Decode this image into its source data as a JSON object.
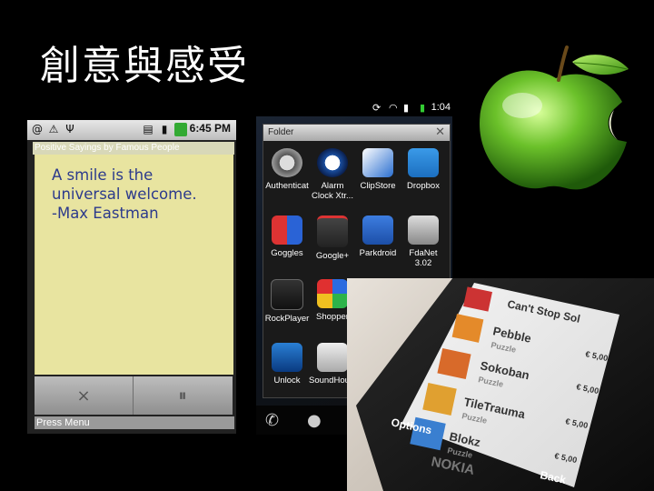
{
  "slide": {
    "title": "創意與感受"
  },
  "phone1": {
    "status_time": "6:45 PM",
    "app_title": "Positive Sayings by Famous People",
    "quote_lines": [
      "A smile is the",
      "universal welcome.",
      "-Max Eastman"
    ],
    "close_symbol": "×",
    "pause_symbol": "⏸",
    "menu_hint": "Press Menu"
  },
  "phone2": {
    "status_time": "1:04",
    "folder_title": "Folder",
    "apps": [
      {
        "label": "Authenticat",
        "icon": "authenticator-icon"
      },
      {
        "label": "Alarm\nClock Xtr...",
        "icon": "alarm-clock-icon"
      },
      {
        "label": "ClipStore",
        "icon": "clipstore-icon"
      },
      {
        "label": "Dropbox",
        "icon": "dropbox-icon"
      },
      {
        "label": "Goggles",
        "icon": "goggles-icon"
      },
      {
        "label": "Google+",
        "icon": "google-plus-icon"
      },
      {
        "label": "Parkdroid",
        "icon": "parkdroid-icon"
      },
      {
        "label": "FdaNet\n3.02",
        "icon": "fdanet-icon"
      },
      {
        "label": "RockPlayer",
        "icon": "rockplayer-icon"
      },
      {
        "label": "Shopper",
        "icon": "shopper-icon"
      },
      {
        "label": "",
        "icon": "hidden-icon"
      },
      {
        "label": "",
        "icon": "hidden-icon"
      },
      {
        "label": "Unlock",
        "icon": "unlock-icon"
      },
      {
        "label": "SoundHound",
        "icon": "microphone-icon"
      }
    ]
  },
  "nokia": {
    "items": [
      {
        "name": "Pebble",
        "genre": "Puzzle",
        "price": "€ 5,00"
      },
      {
        "name": "Sokoban",
        "genre": "Puzzle",
        "price": "€ 5,00"
      },
      {
        "name": "TileTrauma",
        "genre": "Puzzle",
        "price": "€ 5,00"
      },
      {
        "name": "Blokz",
        "genre": "Puzzle",
        "price": "€ 5,00"
      }
    ],
    "top_item": "Can't Stop Sol",
    "options_label": "Options",
    "back_label": "Back",
    "brand": "NOKIA"
  }
}
